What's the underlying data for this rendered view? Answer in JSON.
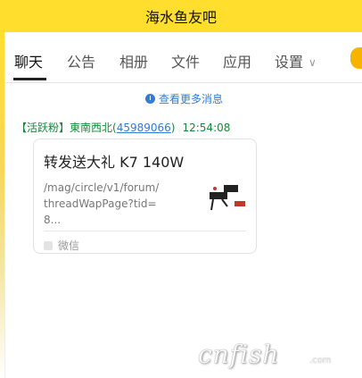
{
  "window": {
    "title": "海水鱼友吧"
  },
  "tabs": [
    {
      "label": "聊天",
      "active": true
    },
    {
      "label": "公告"
    },
    {
      "label": "相册"
    },
    {
      "label": "文件"
    },
    {
      "label": "应用"
    },
    {
      "label": "设置"
    }
  ],
  "chat": {
    "view_more_label": "查看更多消息",
    "message": {
      "badge": "【活跃粉】",
      "sender": "東南西北",
      "uid_prefix": "(",
      "uid": "45989066",
      "uid_suffix": ")",
      "time": "12:54:08",
      "card": {
        "title": "转发送大礼 K7 140W",
        "url": "/mag/circle/v1/forum/threadWapPage?tid=8...",
        "source": "微信"
      }
    }
  },
  "watermark": {
    "text": "cnfish",
    "suffix": ".com"
  },
  "colors": {
    "brand_yellow": "#ffde2e",
    "link_blue": "#2e7ed6",
    "sender_green": "#138a3a"
  }
}
